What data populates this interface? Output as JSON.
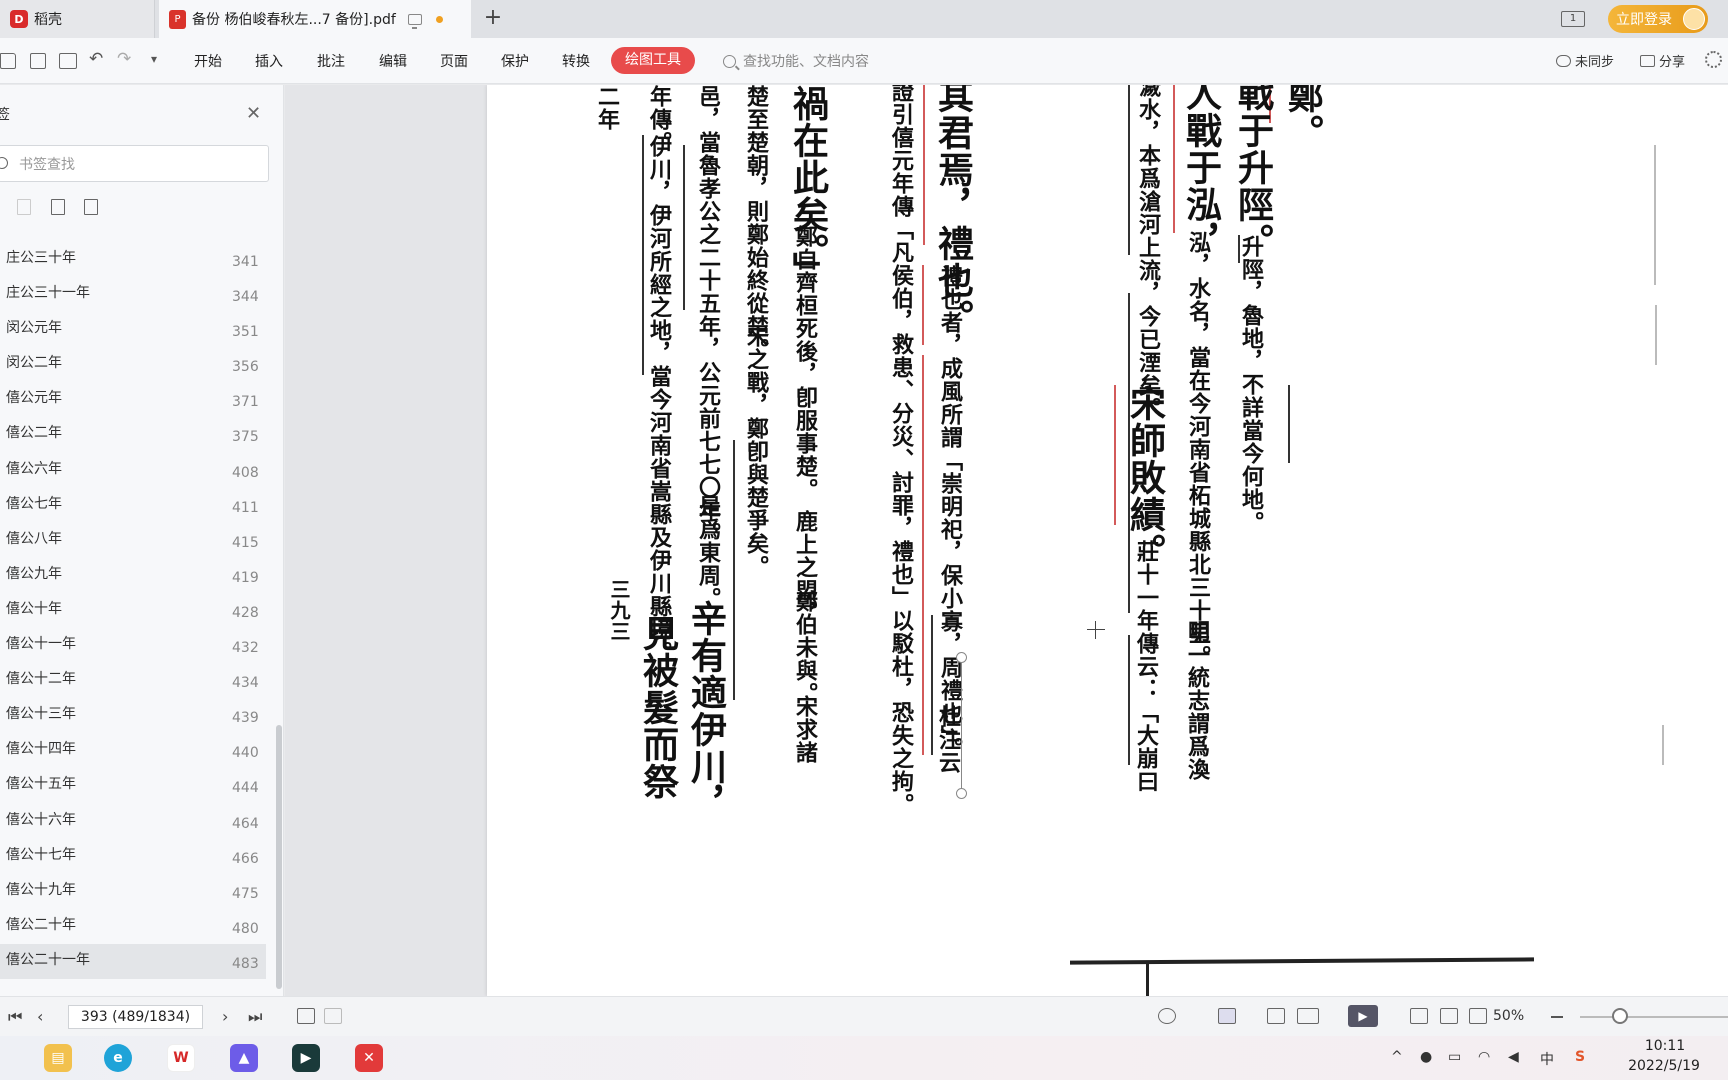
{
  "tabs": {
    "home": "稻壳",
    "document": "备份 杨伯峻春秋左...7 备份].pdf",
    "tab_count": "1",
    "login_label": "立即登录"
  },
  "toolbar": {
    "menu": [
      "开始",
      "插入",
      "批注",
      "编辑",
      "页面",
      "保护",
      "转换"
    ],
    "active_menu": "绘图工具",
    "search_placeholder": "查找功能、文档内容",
    "sync_label": "未同步",
    "share_label": "分享"
  },
  "sidebar": {
    "title": "签",
    "search_placeholder": "书签查找",
    "bookmarks": [
      {
        "label": "庄公三十年",
        "page": "341"
      },
      {
        "label": "庄公三十一年",
        "page": "344"
      },
      {
        "label": "闵公元年",
        "page": "351"
      },
      {
        "label": "闵公二年",
        "page": "356"
      },
      {
        "label": "僖公元年",
        "page": "371"
      },
      {
        "label": "僖公二年",
        "page": "375"
      },
      {
        "label": "僖公六年",
        "page": "408"
      },
      {
        "label": "僖公七年",
        "page": "411"
      },
      {
        "label": "僖公八年",
        "page": "415"
      },
      {
        "label": "僖公九年",
        "page": "419"
      },
      {
        "label": "僖公十年",
        "page": "428"
      },
      {
        "label": "僖公十一年",
        "page": "432"
      },
      {
        "label": "僖公十二年",
        "page": "434"
      },
      {
        "label": "僖公十三年",
        "page": "439"
      },
      {
        "label": "僖公十四年",
        "page": "440"
      },
      {
        "label": "僖公十五年",
        "page": "444"
      },
      {
        "label": "僖公十六年",
        "page": "464"
      },
      {
        "label": "僖公十七年",
        "page": "466"
      },
      {
        "label": "僖公十九年",
        "page": "475"
      },
      {
        "label": "僖公二十年",
        "page": "480"
      },
      {
        "label": "僖公二十一年",
        "page": "483"
      }
    ],
    "active_index": 20
  },
  "document": {
    "columns": [
      {
        "text": "鄭。",
        "size": "big"
      },
      {
        "text": "戰于升陘。",
        "size": "big"
      },
      {
        "text": "升陘，魯地，不詳當今何地。",
        "size": "sm"
      },
      {
        "text": "人戰于泓，",
        "size": "big"
      },
      {
        "text": "泓，水名，當在今河南省柘城縣北三十里。",
        "size": "sm"
      },
      {
        "text": "明一統志謂爲渙",
        "size": "sm"
      },
      {
        "text": "濊水，本爲滄河上流，今已湮矣。",
        "size": "sm"
      },
      {
        "text": "宋師敗績。",
        "size": "big"
      },
      {
        "text": "莊十一年傳云：「大崩曰",
        "size": "sm"
      },
      {
        "text": "其君焉，禮也。",
        "size": "big"
      },
      {
        "text": "禮也者，成風所謂「崇明祀，保小寡，周禮也」。",
        "size": "sm"
      },
      {
        "text": "杜注云",
        "size": "sm"
      },
      {
        "text": "證引僖元年傳「凡侯伯，救患、分災、討罪，禮也」以駁杜，恐失之拘。",
        "size": "sm"
      },
      {
        "text": "禍在此矣。」",
        "size": "big"
      },
      {
        "text": "鄭自齊桓死後，卽服事楚。",
        "size": "sm"
      },
      {
        "text": "鹿上之盟，",
        "size": "sm"
      },
      {
        "text": "鄭伯未與。",
        "size": "sm"
      },
      {
        "text": "宋求諸",
        "size": "sm"
      },
      {
        "text": "楚至楚朝，則鄭始終從楚。",
        "size": "sm"
      },
      {
        "text": "宋之戰，鄭卽與楚爭矣。",
        "size": "sm"
      },
      {
        "text": "邑，當魯孝公之二十五年，公元前七七〇年。",
        "size": "sm"
      },
      {
        "text": "是爲東周。",
        "size": "sm"
      },
      {
        "text": "辛有適伊川，",
        "size": "big"
      },
      {
        "text": "年傳。",
        "size": "sm"
      },
      {
        "text": "伊川，伊河所經之地，當今河南省嵩縣及伊川縣境。",
        "size": "sm"
      },
      {
        "text": "見被髮而祭",
        "size": "big"
      },
      {
        "text": "二年",
        "size": "sm"
      }
    ],
    "page_number": "三九三"
  },
  "statusbar": {
    "page_display": "393 (489/1834)",
    "zoom": "50%"
  },
  "taskbar": {
    "time": "10:11",
    "date": "2022/5/19",
    "ime": "中"
  }
}
